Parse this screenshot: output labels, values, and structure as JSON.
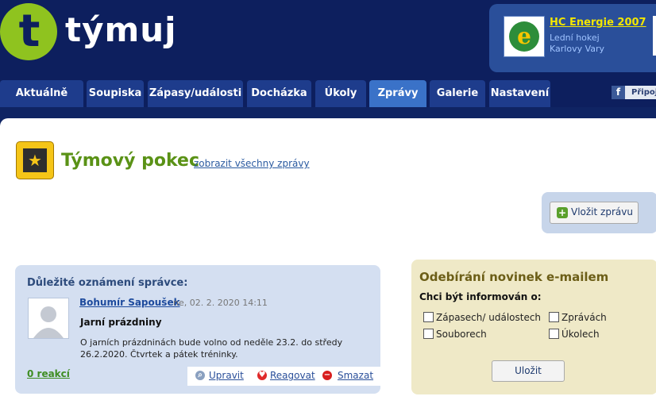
{
  "brand": {
    "name": "týmuj",
    "logo_letter": "t"
  },
  "team": {
    "name": "HC Energie 2007",
    "sport": "Lední hokej",
    "city": "Karlovy Vary",
    "logo_letter": "e"
  },
  "facebook": {
    "label": "Připoj"
  },
  "tabs": [
    {
      "label": "Aktuálně",
      "active": false
    },
    {
      "label": "Soupiska",
      "active": false
    },
    {
      "label": "Zápasy/události",
      "active": false
    },
    {
      "label": "Docházka",
      "active": false
    },
    {
      "label": "Úkoly",
      "active": false
    },
    {
      "label": "Zprávy",
      "active": true
    },
    {
      "label": "Galerie",
      "active": false
    },
    {
      "label": "Nastavení",
      "active": false
    }
  ],
  "page": {
    "title": "Týmový pokec",
    "separator": "-",
    "all_messages_link": "zobrazit všechny zprávy"
  },
  "post_button": {
    "label": "Vložit zprávu"
  },
  "announcement": {
    "heading": "Důležité oznámení správce:",
    "author": "Bohumír Sapoušek",
    "date": "ne, 02. 2. 2020 14:11",
    "subject": "Jarní prázdniny",
    "body": "O jarních prázdninách bude volno od neděle 23.2. do středy 26.2.2020. Čtvrtek a pátek tréninky.",
    "reactions": "0 reakcí",
    "actions": {
      "edit": "Upravit",
      "reply": "Reagovat",
      "delete": "Smazat"
    }
  },
  "subscribe": {
    "title": "Odebírání novinek e-mailem",
    "label": "Chci být informován o:",
    "options": [
      {
        "label": "Zápasech/ událostech",
        "checked": false
      },
      {
        "label": "Zprávách",
        "checked": false
      },
      {
        "label": "Souborech",
        "checked": false
      },
      {
        "label": "Úkolech",
        "checked": false
      }
    ],
    "save_label": "Uložit"
  },
  "colors": {
    "header_bg": "#0d1f5e",
    "accent_green": "#8fc31f",
    "tab_active": "#3a72c8",
    "tab": "#1e3c8c"
  }
}
